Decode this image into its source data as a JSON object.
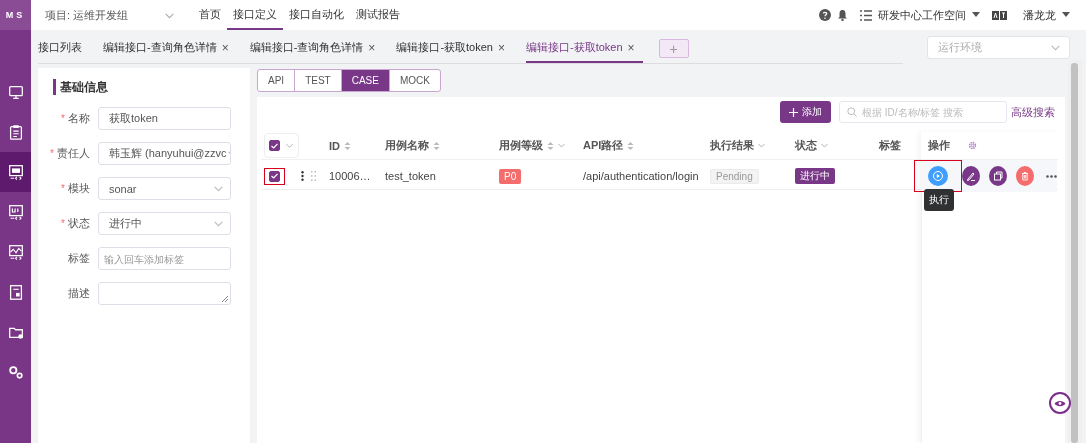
{
  "app": {
    "logo": "MS"
  },
  "sidebar": {
    "items": [
      {
        "selected": false
      },
      {
        "selected": false
      },
      {
        "selected": true
      },
      {
        "selected": false
      },
      {
        "selected": false
      },
      {
        "selected": false
      },
      {
        "selected": false
      },
      {
        "selected": false
      }
    ]
  },
  "topbar": {
    "project": "项目: 运维开发组",
    "nav": [
      {
        "label": "首页",
        "selected": false
      },
      {
        "label": "接口定义",
        "selected": true
      },
      {
        "label": "接口自动化",
        "selected": false
      },
      {
        "label": "测试报告",
        "selected": false
      }
    ],
    "workspace": "研发中心工作空间",
    "user": "潘龙龙"
  },
  "tabs": [
    {
      "label": "接口列表",
      "selected": false
    },
    {
      "label": "编辑接口-查询角色详情",
      "selected": false,
      "close": "×"
    },
    {
      "label": "编辑接口-查询角色详情",
      "selected": false,
      "close": "×"
    },
    {
      "label": "编辑接口-获取token",
      "selected": false,
      "close": "×"
    },
    {
      "label": "编辑接口-获取token",
      "selected": true,
      "close": "×"
    }
  ],
  "add_tab": "+",
  "env_select": {
    "placeholder": "运行环境"
  },
  "form": {
    "title": "基础信息",
    "fields": [
      {
        "label": "名称",
        "mark": "*",
        "kind": "input",
        "value": "获取token"
      },
      {
        "label": "责任人",
        "mark": "*",
        "kind": "select",
        "value": "韩玉辉 (hanyuhui@zzvc"
      },
      {
        "label": "模块",
        "mark": "*",
        "kind": "select",
        "value": "sonar"
      },
      {
        "label": "状态",
        "mark": "*",
        "kind": "select",
        "value": "进行中"
      },
      {
        "label": "标签",
        "kind": "input",
        "placeholder": "输入回车添加标签"
      },
      {
        "label": "描述",
        "kind": "textarea"
      }
    ]
  },
  "subtabs": [
    {
      "label": "API",
      "selected": false
    },
    {
      "label": "TEST",
      "selected": false
    },
    {
      "label": "CASE",
      "selected": true
    },
    {
      "label": "MOCK",
      "selected": false
    }
  ],
  "toolbar": {
    "add_button": "添加",
    "search": {
      "placeholder": "根据 ID/名称/标签 搜索"
    },
    "advanced_link": "高级搜索"
  },
  "table": {
    "header_checked": true,
    "columns": [
      {
        "label": "ID",
        "sort": true,
        "filter": false
      },
      {
        "label": "用例名称",
        "sort": true,
        "filter": false
      },
      {
        "label": "用例等级",
        "sort": true,
        "filter": true
      },
      {
        "label": "API路径",
        "sort": true,
        "filter": false
      },
      {
        "label": "执行结果",
        "sort": false,
        "filter": true
      },
      {
        "label": "状态",
        "sort": false,
        "filter": true
      },
      {
        "label": "标签",
        "sort": false,
        "filter": false
      },
      {
        "label": "操作",
        "sort": false,
        "filter": false,
        "settings": true
      }
    ],
    "rows": [
      {
        "checked": true,
        "highlighted": true,
        "id": "10006…",
        "name": "test_token",
        "priority": "P0",
        "path": "/api/authentication/login",
        "result": "Pending",
        "status": "进行中",
        "actions": [
          {
            "kind": "run",
            "highlighted": true
          },
          {
            "kind": "edit",
            "highlighted": false
          },
          {
            "kind": "copy",
            "highlighted": false
          },
          {
            "kind": "delete",
            "highlighted": false
          },
          {
            "kind": "more",
            "highlighted": false
          }
        ]
      }
    ],
    "tooltip": "执行"
  }
}
